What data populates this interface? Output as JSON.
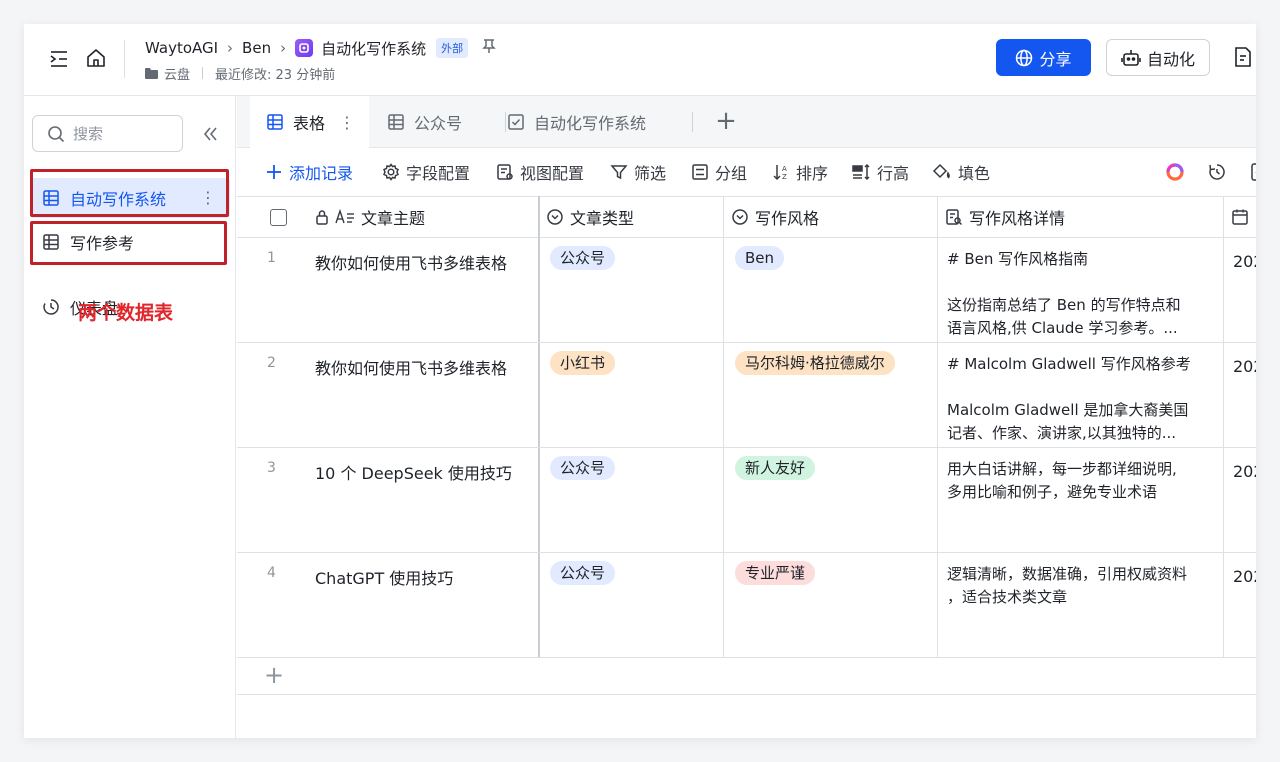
{
  "header": {
    "breadcrumbs": [
      "WaytoAGI",
      "Ben",
      "自动化写作系统"
    ],
    "external_tag": "外部",
    "location": "云盘",
    "last_modified": "最近修改: 23 分钟前",
    "share_label": "分享",
    "automation_label": "自动化"
  },
  "sidebar": {
    "search_placeholder": "搜索",
    "items": [
      {
        "label": "自动写作系统",
        "active": true
      },
      {
        "label": "写作参考",
        "active": false
      },
      {
        "label": "仪表盘",
        "active": false
      }
    ],
    "annotation": "两个数据表"
  },
  "tabs": [
    {
      "label": "表格",
      "active": true
    },
    {
      "label": "公众号",
      "active": false
    },
    {
      "label": "自动化写作系统",
      "active": false
    }
  ],
  "toolbar": {
    "add_record": "添加记录",
    "field_config": "字段配置",
    "view_config": "视图配置",
    "filter": "筛选",
    "group": "分组",
    "sort": "排序",
    "row_height": "行高",
    "fill_color": "填色"
  },
  "columns": {
    "title": "文章主题",
    "type": "文章类型",
    "style": "写作风格",
    "detail": "写作风格详情"
  },
  "rows": [
    {
      "num": "1",
      "title": "教你如何使用飞书多维表格",
      "type": "公众号",
      "type_color": "#e1eaff",
      "style": "Ben",
      "style_color": "#e1eaff",
      "detail_lines": [
        "# Ben 写作风格指南",
        "",
        "这份指南总结了 Ben 的写作特点和",
        "语言风格,供 Claude 学习参考。..."
      ],
      "date": "202"
    },
    {
      "num": "2",
      "title": "教你如何使用飞书多维表格",
      "type": "小红书",
      "type_color": "#fde2c4",
      "style": "马尔科姆·格拉德威尔",
      "style_color": "#fde2c4",
      "detail_lines": [
        "# Malcolm Gladwell 写作风格参考",
        "",
        "Malcolm Gladwell 是加拿大裔美国",
        "记者、作家、演讲家,以其独特的..."
      ],
      "date": "202"
    },
    {
      "num": "3",
      "title": "10 个 DeepSeek 使用技巧",
      "type": "公众号",
      "type_color": "#e1eaff",
      "style": "新人友好",
      "style_color": "#d1f4e0",
      "detail_lines": [
        "用大白话讲解，每一步都详细说明,",
        "多用比喻和例子，避免专业术语"
      ],
      "date": "202"
    },
    {
      "num": "4",
      "title": "ChatGPT 使用技巧",
      "type": "公众号",
      "type_color": "#e1eaff",
      "style": "专业严谨",
      "style_color": "#fddcdc",
      "detail_lines": [
        "逻辑清晰，数据准确，引用权威资料",
        "，适合技术类文章"
      ],
      "date": "202"
    }
  ],
  "colors": {
    "accent": "#1456f0",
    "annotation_red": "#e0262b"
  }
}
